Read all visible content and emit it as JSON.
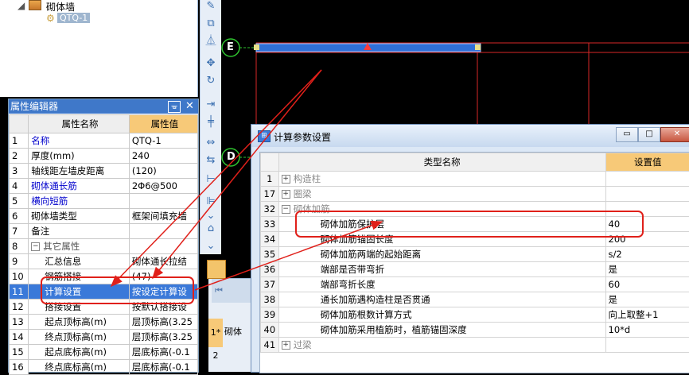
{
  "tree": {
    "parent_label": "砌体墙",
    "child_label": "QTQ-1"
  },
  "property_editor": {
    "title": "属性编辑器",
    "col_name": "属性名称",
    "col_value": "属性值",
    "rows": [
      {
        "num": "1",
        "name": "名称",
        "value": "QTQ-1",
        "blue": true
      },
      {
        "num": "2",
        "name": "厚度(mm)",
        "value": "240",
        "blue": false
      },
      {
        "num": "3",
        "name": "轴线距左墙皮距离",
        "value": "(120)",
        "blue": false
      },
      {
        "num": "4",
        "name": "砌体通长筋",
        "value": "2Φ6@500",
        "blue": true
      },
      {
        "num": "5",
        "name": "横向短筋",
        "value": "",
        "blue": true
      },
      {
        "num": "6",
        "name": "砌体墙类型",
        "value": "框架间填充墙",
        "blue": false
      },
      {
        "num": "7",
        "name": "备注",
        "value": "",
        "blue": false
      },
      {
        "num": "8",
        "name": "其它属性",
        "value": "",
        "blue": false
      },
      {
        "num": "9",
        "name": "汇总信息",
        "value": "砌体通长拉结",
        "blue": false
      },
      {
        "num": "10",
        "name": "钢筋搭接",
        "value": "(47)",
        "blue": false
      },
      {
        "num": "11",
        "name": "计算设置",
        "value": "按设定计算设",
        "blue": false
      },
      {
        "num": "12",
        "name": "搭接设置",
        "value": "按默认搭接设",
        "blue": false
      },
      {
        "num": "13",
        "name": "起点顶标高(m)",
        "value": "层顶标高(3.25",
        "blue": false
      },
      {
        "num": "14",
        "name": "终点顶标高(m)",
        "value": "层顶标高(3.25",
        "blue": false
      },
      {
        "num": "15",
        "name": "起点底标高(m)",
        "value": "层底标高(-0.1",
        "blue": false
      },
      {
        "num": "16",
        "name": "终点底标高(m)",
        "value": "层底标高(-0.1",
        "blue": false
      }
    ]
  },
  "drawing": {
    "axis_e": "E",
    "axis_d": "D"
  },
  "dialog": {
    "title": "计算参数设置",
    "col_name": "类型名称",
    "col_value": "设置值",
    "rows": [
      {
        "num": "1",
        "name": "构造柱",
        "value": "",
        "group": true,
        "sign": "+"
      },
      {
        "num": "17",
        "name": "圈梁",
        "value": "",
        "group": true,
        "sign": "+"
      },
      {
        "num": "32",
        "name": "砌体加筋",
        "value": "",
        "group": true,
        "sign": "−"
      },
      {
        "num": "33",
        "name": "砌体加筋保护层",
        "value": "40",
        "group": false
      },
      {
        "num": "34",
        "name": "砌体加筋锚固长度",
        "value": "200",
        "group": false
      },
      {
        "num": "35",
        "name": "砌体加筋两端的起始距离",
        "value": "s/2",
        "group": false
      },
      {
        "num": "36",
        "name": "端部是否带弯折",
        "value": "是",
        "group": false
      },
      {
        "num": "37",
        "name": "端部弯折长度",
        "value": "60",
        "group": false
      },
      {
        "num": "38",
        "name": "通长加筋遇构造柱是否贯通",
        "value": "是",
        "group": false
      },
      {
        "num": "39",
        "name": "砌体加筋根数计算方式",
        "value": "向上取整+1",
        "group": false
      },
      {
        "num": "40",
        "name": "砌体加筋采用植筋时，植筋锚固深度",
        "value": "10*d",
        "group": false
      },
      {
        "num": "41",
        "name": "过梁",
        "value": "",
        "group": true,
        "sign": "+"
      }
    ]
  },
  "mini_table": {
    "row1": "1*",
    "row2": "2",
    "cell": "砌体"
  },
  "colors": {
    "accent": "#3a79d9",
    "header_value": "#f7c978",
    "annotation": "#e0201a",
    "wall_line": "#d82828"
  }
}
